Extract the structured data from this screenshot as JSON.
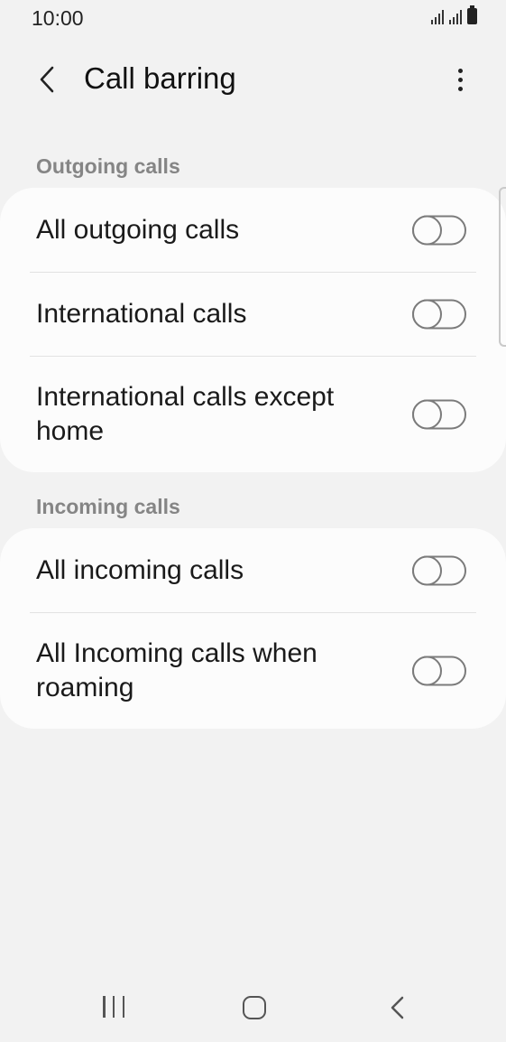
{
  "status_bar": {
    "time": "10:00"
  },
  "app_bar": {
    "title": "Call barring",
    "back_icon": "chevron-left-icon",
    "more_icon": "more-vertical-icon"
  },
  "sections": [
    {
      "header": "Outgoing calls",
      "items": [
        {
          "label": "All outgoing calls",
          "enabled": false
        },
        {
          "label": "International calls",
          "enabled": false
        },
        {
          "label": "International calls except home",
          "enabled": false
        }
      ]
    },
    {
      "header": "Incoming calls",
      "items": [
        {
          "label": "All incoming calls",
          "enabled": false
        },
        {
          "label": "All Incoming calls when roaming",
          "enabled": false
        }
      ]
    }
  ],
  "nav_bar": {
    "recents_icon": "recents-icon",
    "home_icon": "home-icon",
    "back_icon": "back-icon"
  },
  "colors": {
    "background": "#f2f2f2",
    "card": "#fcfcfc",
    "section_header": "#858585",
    "toggle_off": "#7b7b7b"
  }
}
